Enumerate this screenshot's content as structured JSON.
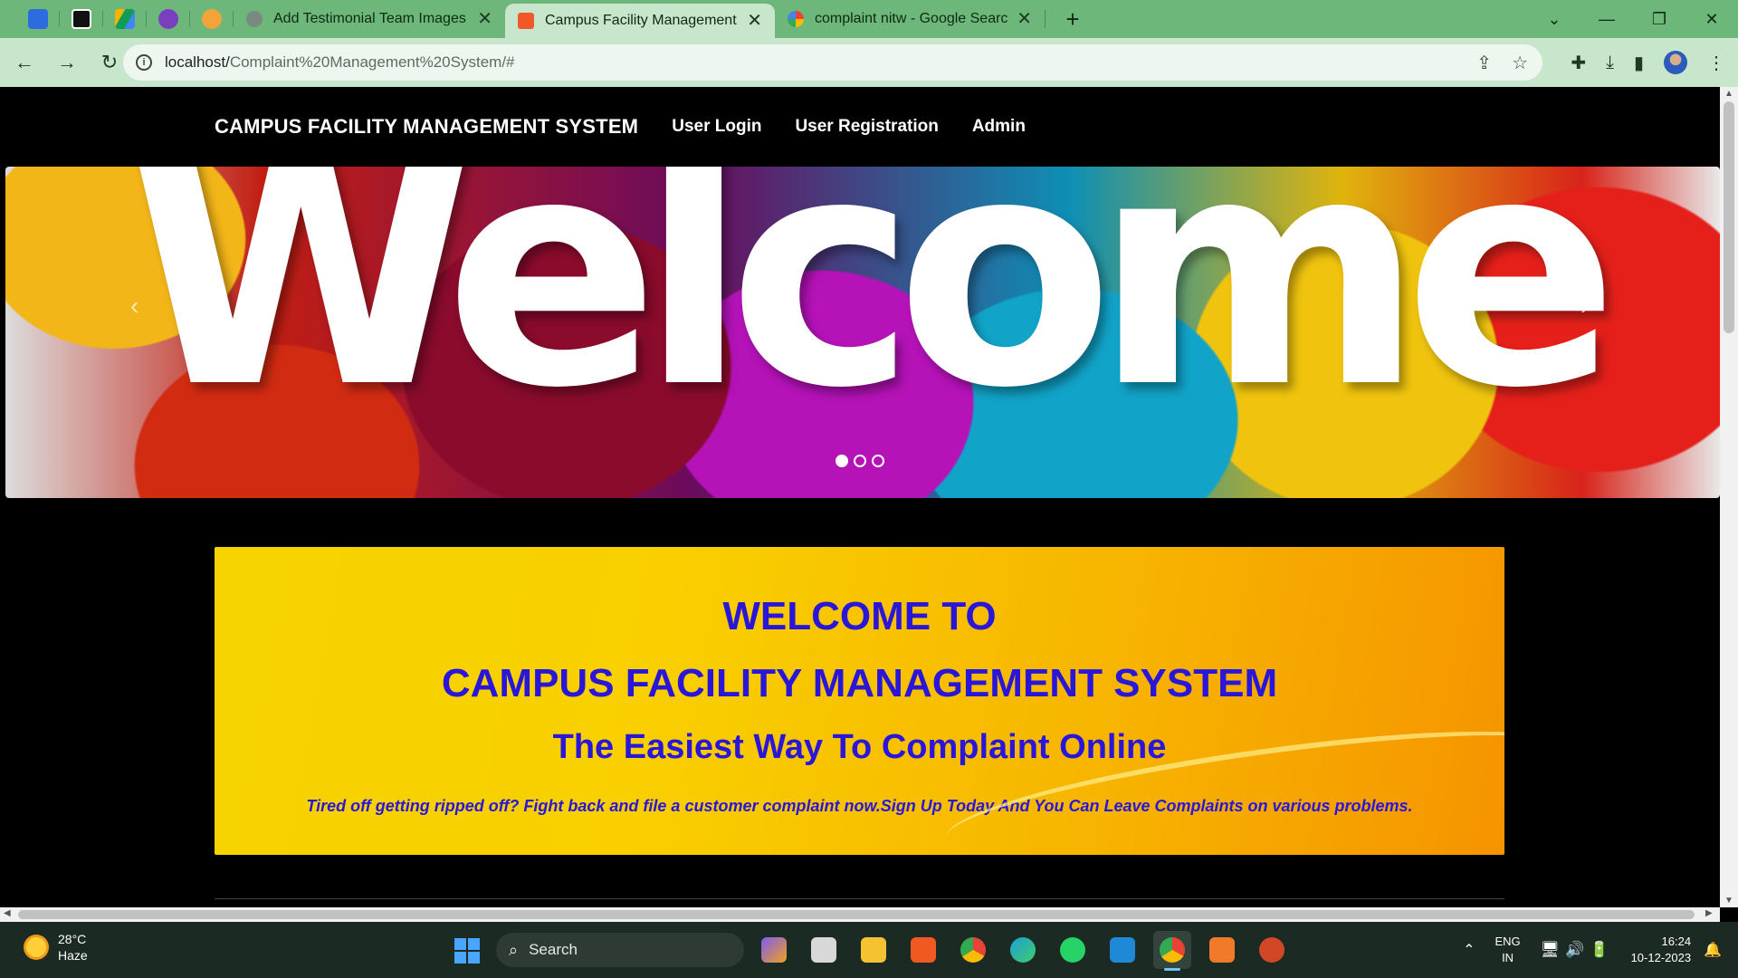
{
  "browser": {
    "tabs": [
      {
        "title": "Add Testimonial Team Images",
        "close": "✕",
        "favicon_color": "#7b8a7e"
      },
      {
        "title": "Campus Facility Management Sy",
        "close": "✕",
        "favicon_color": "#f0572a",
        "active": true
      },
      {
        "title": "complaint nitw - Google Search",
        "close": "✕",
        "favicon_color": "#4285f4"
      }
    ],
    "pinned_icons": [
      "app-icon-1",
      "app-icon-2",
      "drive-icon",
      "app-icon-4",
      "app-icon-5"
    ],
    "new_tab_label": "+",
    "window_controls": {
      "dropdown": "⌄",
      "minimize": "—",
      "restore": "❐",
      "close": "✕"
    },
    "nav": {
      "back": "←",
      "forward": "→",
      "reload": "↻"
    },
    "url": {
      "host": "localhost/",
      "path": "Complaint%20Management%20System/#"
    },
    "omni_actions": {
      "share": "⇪",
      "bookmark": "☆"
    },
    "toolbar_actions": {
      "extensions": "✚",
      "download": "⤓",
      "sidepanel": "▮",
      "menu": "⋮"
    }
  },
  "site": {
    "brand": "CAMPUS FACILITY MANAGEMENT SYSTEM",
    "nav_links": [
      "User Login",
      "User Registration",
      "Admin"
    ],
    "carousel": {
      "word": "Welcome",
      "prev": "‹",
      "next": "›",
      "slides": 3,
      "active_slide": 0
    },
    "panel": {
      "heading1": "WELCOME TO",
      "heading2": "CAMPUS FACILITY MANAGEMENT SYSTEM",
      "subtitle": "The Easiest Way To Complaint Online",
      "tagline": "Tired off getting ripped off? Fight back and file a customer complaint now.Sign Up Today And You Can Leave Complaints on various problems."
    }
  },
  "taskbar": {
    "weather": {
      "temp": "28°C",
      "condition": "Haze"
    },
    "search_placeholder": "Search",
    "apps": [
      {
        "name": "copilot-app",
        "color": "#7c5cf0"
      },
      {
        "name": "task-view-app",
        "color": "#d8d8d8"
      },
      {
        "name": "file-explorer-app",
        "color": "#f5c231"
      },
      {
        "name": "brave-app",
        "color": "#f05a22"
      },
      {
        "name": "chrome-app",
        "color": "#34a853"
      },
      {
        "name": "edge-app",
        "color": "#1fa0d8"
      },
      {
        "name": "whatsapp-app",
        "color": "#25d366"
      },
      {
        "name": "vscode-app",
        "color": "#1e8ad6"
      },
      {
        "name": "chrome-profile-app",
        "color": "#4285f4",
        "active": true
      },
      {
        "name": "xampp-app",
        "color": "#f07a2a"
      },
      {
        "name": "powerpoint-app",
        "color": "#d24726"
      }
    ],
    "tray": {
      "chevron": "⌃",
      "lang1": "ENG",
      "lang2": "IN",
      "sys_icons": "🖥🔊🔋",
      "time": "16:24",
      "date": "10-12-2023",
      "bell": "🔔"
    }
  }
}
